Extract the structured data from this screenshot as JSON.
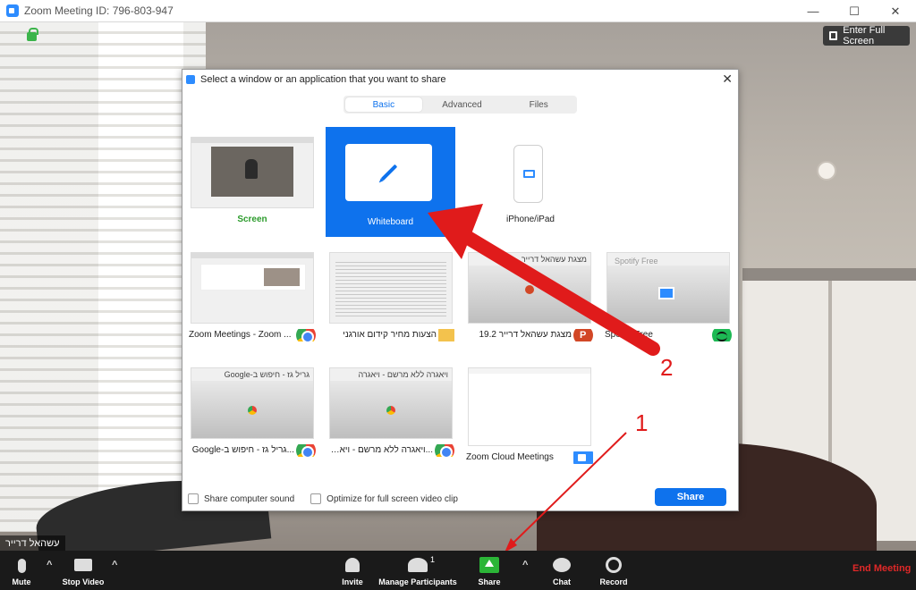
{
  "window": {
    "title": "Zoom Meeting ID: 796-803-947",
    "controls": [
      "—",
      "☐",
      "✕"
    ]
  },
  "fullscreen_label": "Enter Full Screen",
  "participant_name": "עשהאל דרייר",
  "dialog": {
    "title": "Select a window or an application that you want to share",
    "close": "✕",
    "tabs": [
      {
        "label": "Basic",
        "active": true
      },
      {
        "label": "Advanced",
        "active": false
      },
      {
        "label": "Files",
        "active": false
      }
    ],
    "tiles": [
      {
        "label": "Screen",
        "app": "none"
      },
      {
        "label": "Whiteboard",
        "app": "pencil-icon",
        "selected": true
      },
      {
        "label": "iPhone/iPad",
        "app": "airplay-icon"
      },
      {
        "label": "Zoom Meetings - Zoom ...",
        "app": "chrome"
      },
      {
        "label": "הצעות מחיר קידום אורגני",
        "app": "folder"
      },
      {
        "label": "מצגת עשהאל דרייר 19.2",
        "app": "powerpoint",
        "thumb_title": "מצגת עשהאל דרייר"
      },
      {
        "label": "Spotify Free",
        "app": "spotify",
        "thumb_title": "Spotify Free"
      },
      {
        "label": "...גריל גז - חיפוש ב-Google",
        "app": "chrome",
        "thumb_title": "גריל גז - חיפוש ב-Google"
      },
      {
        "label": "...ויאגרה ללא מרשם - ויאגרה",
        "app": "chrome",
        "thumb_title": "ויאגרה ללא מרשם - ויאגרה"
      },
      {
        "label": "Zoom Cloud Meetings",
        "app": "zoom"
      }
    ],
    "footer": {
      "share_sound": "Share computer sound",
      "optimize": "Optimize for full screen video clip",
      "share_button": "Share"
    }
  },
  "annotations": {
    "one": "1",
    "two": "2"
  },
  "toolbar": {
    "mute": "Mute",
    "stop_video": "Stop Video",
    "invite": "Invite",
    "manage_participants": "Manage Participants",
    "participant_count": "1",
    "share": "Share",
    "chat": "Chat",
    "record": "Record",
    "end_meeting": "End Meeting",
    "caret": "^"
  },
  "colors": {
    "accent": "#0e72ed",
    "share_green": "#2bb537",
    "end_red": "#e02828",
    "annotation_red": "#e01b1b"
  }
}
